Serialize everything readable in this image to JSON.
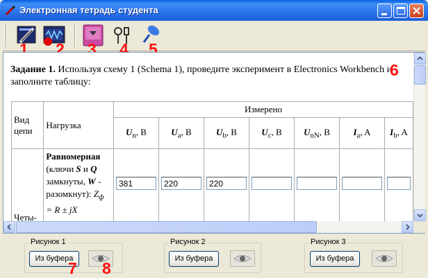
{
  "window": {
    "title": "Электронная тетрадь студента",
    "title_icon": "pencil-icon",
    "accent": "#2a74ea"
  },
  "toolbar": {
    "buttons": [
      {
        "icon": "circuit-board-icon",
        "number": "1"
      },
      {
        "icon": "oscilloscope-icon",
        "number": "2"
      },
      {
        "icon": "notebook-dropdown-icon",
        "number": "3"
      },
      {
        "icon": "tools-icon",
        "number": "4"
      },
      {
        "icon": "blue-pin-icon",
        "number": "5"
      }
    ]
  },
  "document": {
    "marker_6": "6",
    "task_label": "Задание 1.",
    "task_text": " Используя схему 1 (Schema 1), проведите эксперимент в Electronics Workbench и   заполните таблицу:",
    "table": {
      "col_type": "Вид цепи",
      "col_load": "Нагрузка",
      "measured": "Измерено",
      "headers": [
        {
          "sym": "U",
          "sub": "n",
          "unit": ", В"
        },
        {
          "sym": "U",
          "sub": "a",
          "unit": ",    В"
        },
        {
          "sym": "U",
          "sub": "b",
          "unit": ", В"
        },
        {
          "sym": "U",
          "sub": "c",
          "unit": ", В"
        },
        {
          "sym": "U",
          "sub": "nN",
          "unit": ", В"
        },
        {
          "sym": "I",
          "sub": "a",
          "unit": ", A"
        },
        {
          "sym": "I",
          "sub": "b",
          "unit": ", A"
        }
      ],
      "row1": {
        "type": "Четы-",
        "load_bold": "Равномерная",
        "load_text_1": "(ключи ",
        "load_s": "S",
        "load_and": " и ",
        "load_q": "Q",
        "load_text_2": " замкнуты, ",
        "load_w": "W",
        "load_text_3": " - разомкнут): ",
        "load_z": "Z",
        "load_phi": "ф",
        "load_eq": " = R ± jX",
        "values": [
          "381",
          "220",
          "220",
          "",
          "",
          "",
          ""
        ]
      }
    }
  },
  "bottom": {
    "groups": [
      {
        "label": "Рисунок 1",
        "button": "Из буфера",
        "eye_icon": "eye-icon"
      },
      {
        "label": "Рисунок 2",
        "button": "Из буфера",
        "eye_icon": "eye-icon"
      },
      {
        "label": "Рисунок 3",
        "button": "Из буфера",
        "eye_icon": "eye-icon"
      }
    ],
    "marker_7": "7",
    "marker_8": "8"
  }
}
